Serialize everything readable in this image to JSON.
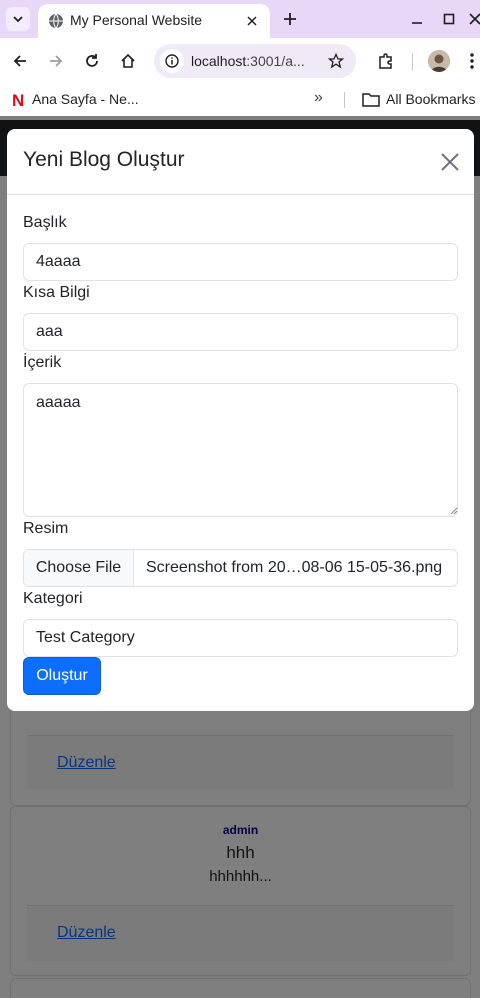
{
  "browser": {
    "tab_title": "My Personal Website",
    "url_host": "localhost",
    "url_rest": ":3001/a...",
    "bookmarks": {
      "netflix_label": "Ana Sayfa - Ne...",
      "more": "»",
      "all_bookmarks": "All Bookmarks"
    }
  },
  "page": {
    "cards": [
      {
        "author": "",
        "title": "",
        "summary": "",
        "link": "Düzenle"
      },
      {
        "author": "admin",
        "title": "hhh",
        "summary": "hhhhhh...",
        "link": "Düzenle"
      }
    ]
  },
  "modal": {
    "title": "Yeni Blog Oluştur",
    "fields": {
      "title_label": "Başlık",
      "title_value": "4aaaa",
      "summary_label": "Kısa Bilgi",
      "summary_value": "aaa",
      "content_label": "İçerik",
      "content_value": "aaaaa",
      "image_label": "Resim",
      "file_button": "Choose File",
      "file_name": "Screenshot from 20…08-06 15-05-36.png",
      "category_label": "Kategori",
      "category_value": "Test Category"
    },
    "submit_label": "Oluştur"
  },
  "colors": {
    "primary": "#0d6efd",
    "author": "#00008b",
    "tabstrip": "#e8d7f7"
  }
}
